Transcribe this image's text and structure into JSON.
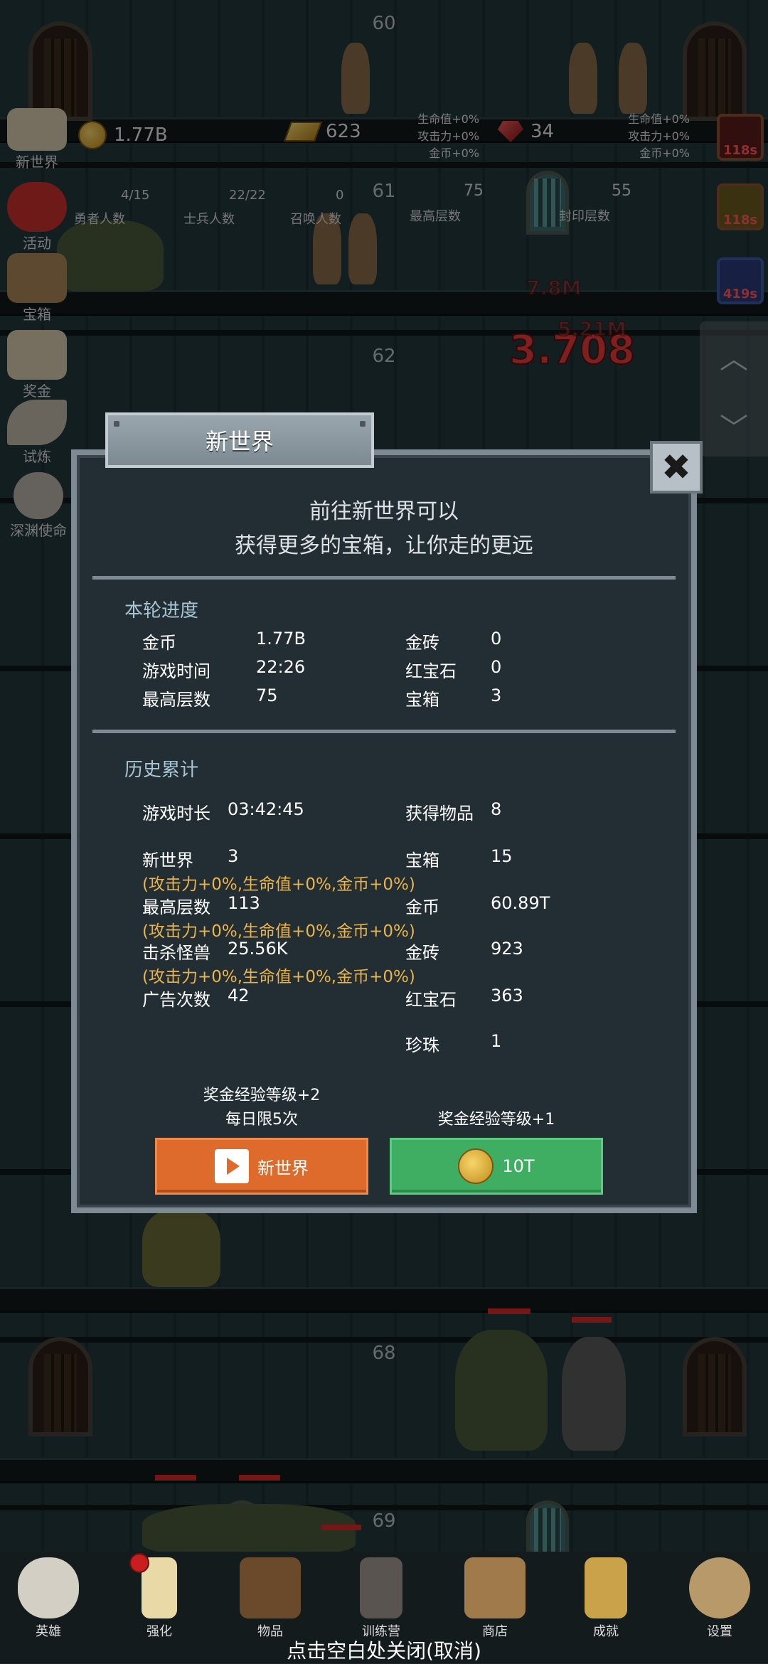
{
  "floors": [
    "60",
    "61",
    "62",
    "68",
    "69"
  ],
  "top_stats": {
    "gold": "1.77B",
    "gold_bars": "623",
    "rubies": "34",
    "bonus_left": [
      "生命值+0%",
      "攻击力+0%",
      "金币+0%"
    ],
    "bonus_right": [
      "生命值+0%",
      "攻击力+0%",
      "金币+0%"
    ],
    "hero_count": "4/15",
    "hero_label": "勇者人数",
    "soldier_count": "22/22",
    "soldier_label": "士兵人数",
    "summon_count": "0",
    "summon_label": "召唤人数",
    "top_floor": "75",
    "top_floor_label": "最高层数",
    "seal_floor": "55",
    "seal_floor_label": "封印层数"
  },
  "side_menu": [
    "新世界",
    "活动",
    "宝箱",
    "奖金",
    "试炼",
    "深渊使命"
  ],
  "timers": [
    "118s",
    "118s",
    "419s"
  ],
  "damage": [
    "3.708",
    "7.8M",
    "5.21M"
  ],
  "dialog": {
    "title": "新世界",
    "intro_line1": "前往新世界可以",
    "intro_line2": "获得更多的宝箱，让你走的更远",
    "round_title": "本轮进度",
    "round": {
      "gold_label": "金币",
      "gold_value": "1.77B",
      "time_label": "游戏时间",
      "time_value": "22:26",
      "top_label": "最高层数",
      "top_value": "75",
      "bar_label": "金砖",
      "bar_value": "0",
      "ruby_label": "红宝石",
      "ruby_value": "0",
      "chest_label": "宝箱",
      "chest_value": "3"
    },
    "history_title": "历史累计",
    "history": {
      "playtime_label": "游戏时长",
      "playtime_value": "03:42:45",
      "items_label": "获得物品",
      "items_value": "8",
      "newworld_label": "新世界",
      "newworld_value": "3",
      "chest_label": "宝箱",
      "chest_value": "15",
      "bonus1": "(攻击力+0%,生命值+0%,金币+0%)",
      "topfloor_label": "最高层数",
      "topfloor_value": "113",
      "gold_label": "金币",
      "gold_value": "60.89T",
      "bonus2": "(攻击力+0%,生命值+0%,金币+0%)",
      "kills_label": "击杀怪兽",
      "kills_value": "25.56K",
      "bar_label": "金砖",
      "bar_value": "923",
      "bonus3": "(攻击力+0%,生命值+0%,金币+0%)",
      "ads_label": "广告次数",
      "ads_value": "42",
      "ruby_label": "红宝石",
      "ruby_value": "363",
      "pearl_label": "珍珠",
      "pearl_value": "1"
    },
    "left_caption_1": "奖金经验等级+2",
    "left_caption_2": "每日限5次",
    "right_caption": "奖金经验等级+1",
    "left_button": "新世界",
    "right_button": "10T",
    "close_icon": "close-icon"
  },
  "nav": [
    "英雄",
    "强化",
    "物品",
    "训练营",
    "商店",
    "成就",
    "设置"
  ],
  "close_hint": "点击空白处关闭(取消)"
}
